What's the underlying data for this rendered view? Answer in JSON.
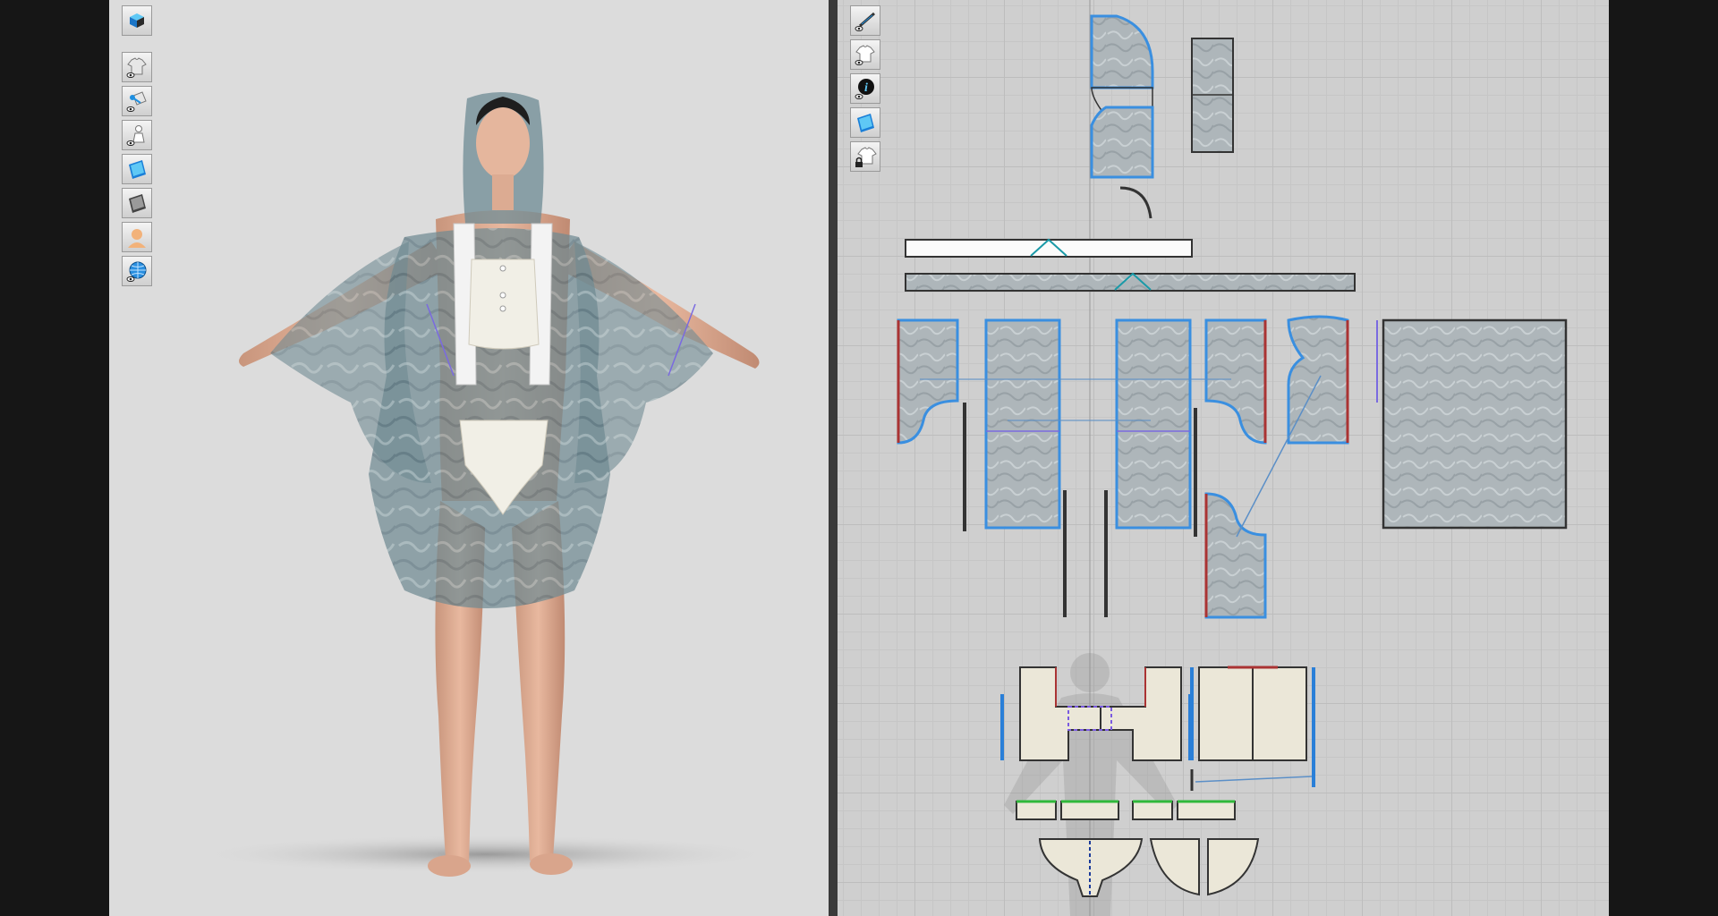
{
  "app": {
    "accent_color": "#2a8fe0",
    "background_3d": "#dcdcdc",
    "background_2d": "#cfcfcf"
  },
  "toolbar_3d": {
    "items": [
      {
        "icon": "scene-cube-icon",
        "label": ""
      },
      {
        "icon": "show-garment-icon",
        "label": ""
      },
      {
        "icon": "show-pins-icon",
        "label": ""
      },
      {
        "icon": "show-avatar-icon",
        "label": ""
      },
      {
        "icon": "texture-view-icon",
        "label": ""
      },
      {
        "icon": "shaded-view-icon",
        "label": ""
      },
      {
        "icon": "avatar-skin-icon",
        "label": ""
      },
      {
        "icon": "environment-globe-icon",
        "label": ""
      }
    ]
  },
  "toolbar_2d": {
    "items": [
      {
        "icon": "show-sewing-icon",
        "label": ""
      },
      {
        "icon": "show-pattern-icon",
        "label": ""
      },
      {
        "icon": "info-icon",
        "label": "i"
      },
      {
        "icon": "texture-view-icon",
        "label": ""
      },
      {
        "icon": "lock-garment-icon",
        "label": ""
      }
    ]
  }
}
